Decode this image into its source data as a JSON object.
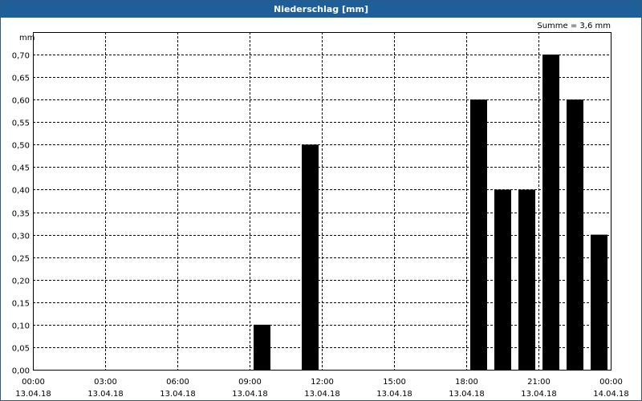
{
  "window": {
    "title": "Niederschlag [mm]"
  },
  "colors": {
    "titlebar": "#1f5f99",
    "bars": "#000000",
    "grid": "#000000"
  },
  "chart_data": {
    "type": "bar",
    "title": "Niederschlag [mm]",
    "unit_label": "mm",
    "annotation": "Summe = 3,6 mm",
    "ylim": [
      0,
      0.75
    ],
    "y_ticks": [
      0,
      0.05,
      0.1,
      0.15,
      0.2,
      0.25,
      0.3,
      0.35,
      0.4,
      0.45,
      0.5,
      0.55,
      0.6,
      0.65,
      0.7
    ],
    "y_tick_labels": [
      "0,00",
      "0,05",
      "0,10",
      "0,15",
      "0,20",
      "0,25",
      "0,30",
      "0,35",
      "0,40",
      "0,45",
      "0,50",
      "0,55",
      "0,60",
      "0,65",
      "0,70"
    ],
    "x_ticks": [
      {
        "time": "00:00",
        "date": "13.04.18"
      },
      {
        "time": "03:00",
        "date": "13.04.18"
      },
      {
        "time": "06:00",
        "date": "13.04.18"
      },
      {
        "time": "09:00",
        "date": "13.04.18"
      },
      {
        "time": "12:00",
        "date": "13.04.18"
      },
      {
        "time": "15:00",
        "date": "13.04.18"
      },
      {
        "time": "18:00",
        "date": "13.04.18"
      },
      {
        "time": "21:00",
        "date": "13.04.18"
      },
      {
        "time": "00:00",
        "date": "14.04.18"
      }
    ],
    "x_range_hours": [
      0,
      24
    ],
    "bars": [
      {
        "start": "09:00",
        "end": "10:00",
        "value": 0.1
      },
      {
        "start": "11:00",
        "end": "12:00",
        "value": 0.5
      },
      {
        "start": "18:00",
        "end": "19:00",
        "value": 0.6
      },
      {
        "start": "19:00",
        "end": "20:00",
        "value": 0.4
      },
      {
        "start": "20:00",
        "end": "21:00",
        "value": 0.4
      },
      {
        "start": "21:00",
        "end": "22:00",
        "value": 0.7
      },
      {
        "start": "22:00",
        "end": "23:00",
        "value": 0.6
      },
      {
        "start": "23:00",
        "end": "00:00",
        "value": 0.3
      }
    ],
    "grid": true
  }
}
